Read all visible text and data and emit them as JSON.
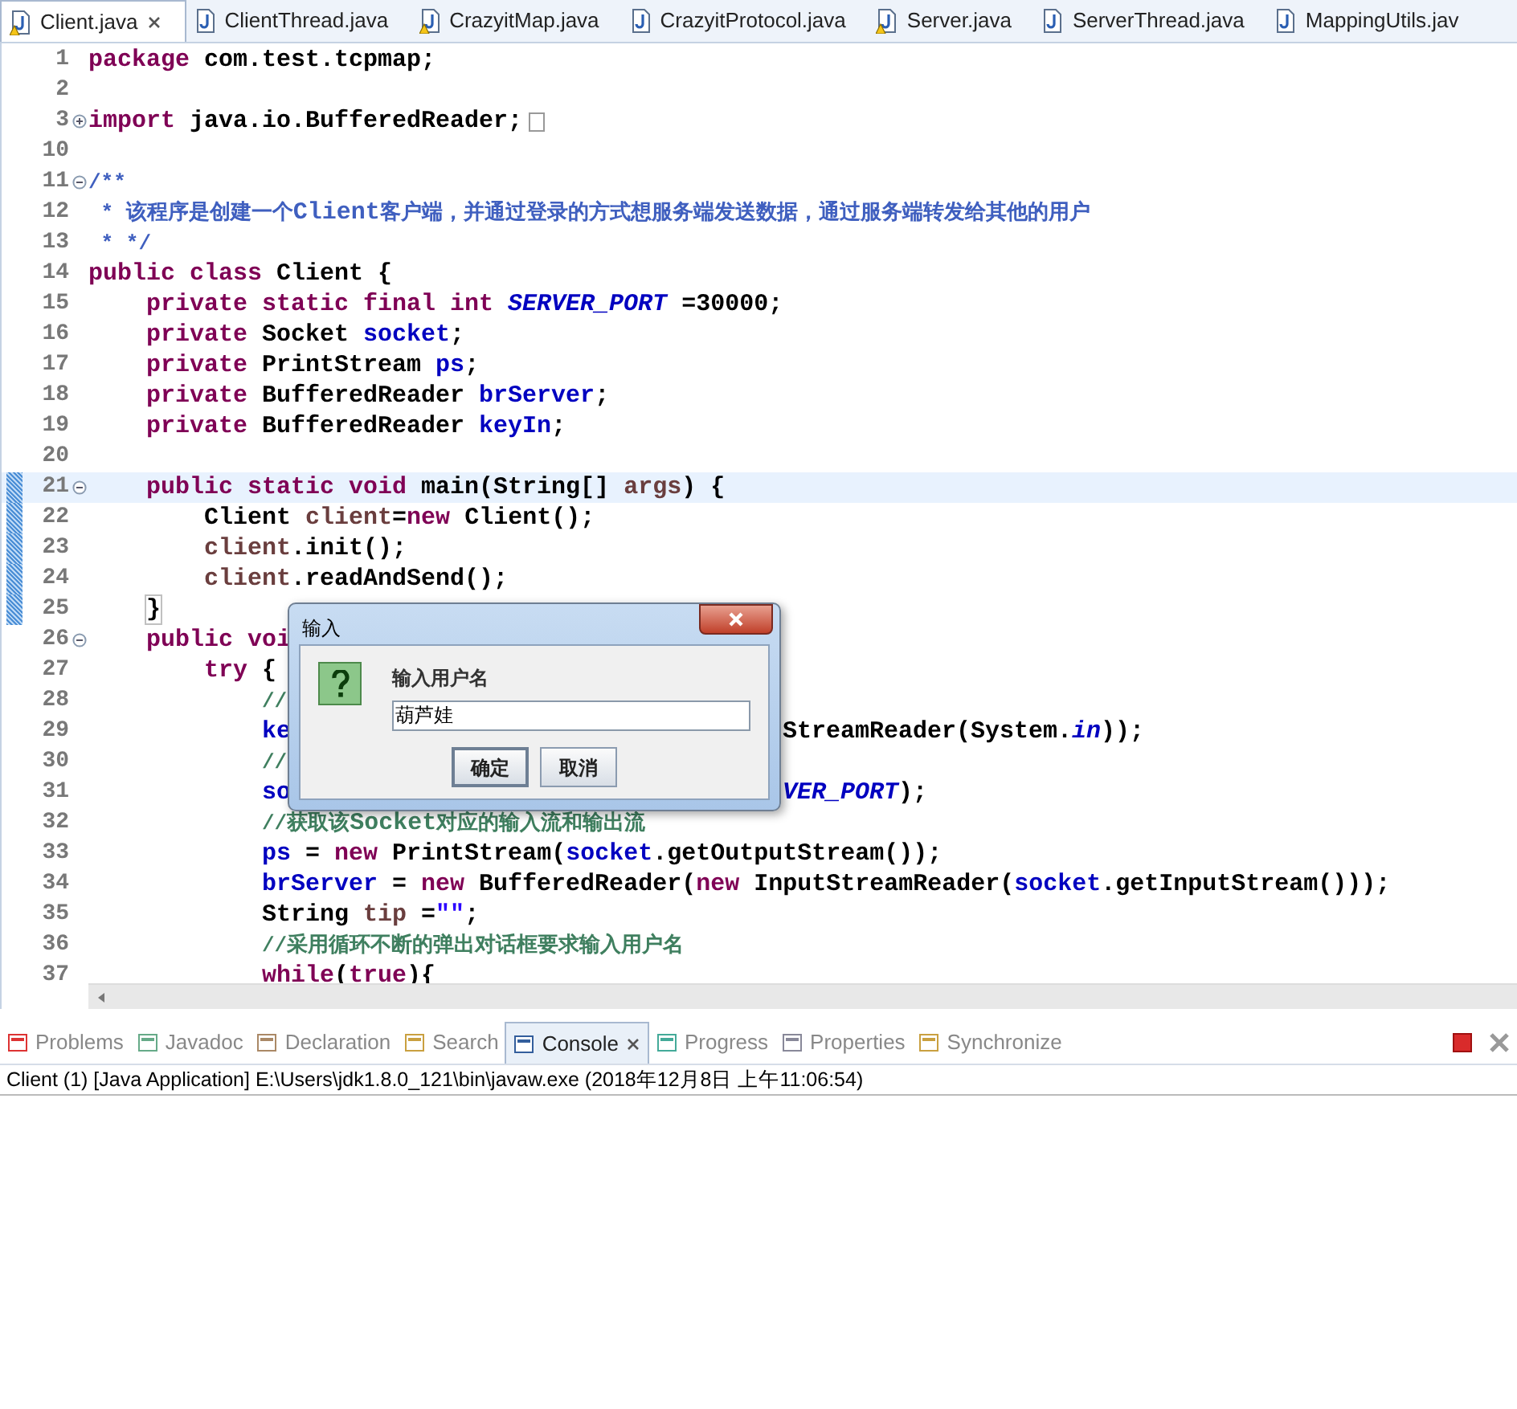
{
  "editor_tabs": [
    {
      "label": "Client.java",
      "selected": true,
      "warning": true
    },
    {
      "label": "ClientThread.java",
      "selected": false,
      "warning": false
    },
    {
      "label": "CrazyitMap.java",
      "selected": false,
      "warning": true
    },
    {
      "label": "CrazyitProtocol.java",
      "selected": false,
      "warning": false
    },
    {
      "label": "Server.java",
      "selected": false,
      "warning": true
    },
    {
      "label": "ServerThread.java",
      "selected": false,
      "warning": false
    },
    {
      "label": "MappingUtils.jav",
      "selected": false,
      "warning": false
    }
  ],
  "code_lines": [
    {
      "number": "1",
      "current": false,
      "changed": false,
      "tokens": [
        {
          "kind": "keyword",
          "text": "package"
        },
        {
          "kind": "plain",
          "text": " com.test.tcpmap;"
        }
      ]
    },
    {
      "number": "2",
      "current": false,
      "changed": false
    },
    {
      "number": "3",
      "current": false,
      "changed": false,
      "expanded": false,
      "tokens": [
        {
          "kind": "keyword",
          "text": "import"
        },
        {
          "kind": "plain",
          "text": " java.io.BufferedReader;"
        }
      ]
    },
    {
      "number": "10",
      "current": false,
      "changed": false
    },
    {
      "number": "11",
      "current": false,
      "changed": false,
      "expanded": true,
      "tokens": [
        {
          "kind": "javadoc",
          "text": "/**"
        }
      ]
    },
    {
      "number": "12",
      "current": false,
      "changed": false,
      "tokens": [
        {
          "kind": "javadoc",
          "text": " * 该程序是创建一个"
        },
        {
          "kind": "javadoc_bold",
          "text": "Client"
        },
        {
          "kind": "javadoc",
          "text": "客户端，并通过登录的方式想服务端发送数据，通过服务端转发给其他的用户"
        }
      ]
    },
    {
      "number": "13",
      "current": false,
      "changed": false,
      "tokens": [
        {
          "kind": "javadoc",
          "text": " * */"
        }
      ]
    },
    {
      "number": "14",
      "current": false,
      "changed": false,
      "tokens": [
        {
          "kind": "keyword",
          "text": "public class"
        },
        {
          "kind": "plain",
          "text": " Client {"
        }
      ],
      "children": [
        {
          "number": "15",
          "current": false,
          "changed": false,
          "tokens": [
            {
              "kind": "keyword",
              "text": "private static final int "
            },
            {
              "kind": "constant",
              "text": "SERVER_PORT"
            },
            {
              "kind": "plain",
              "text": " =30000;"
            }
          ]
        },
        {
          "number": "16",
          "current": false,
          "changed": false,
          "tokens": [
            {
              "kind": "keyword",
              "text": "private"
            },
            {
              "kind": "plain",
              "text": " Socket "
            },
            {
              "kind": "field",
              "text": "socket"
            },
            {
              "kind": "plain",
              "text": ";"
            }
          ]
        },
        {
          "number": "17",
          "current": false,
          "changed": false,
          "tokens": [
            {
              "kind": "keyword",
              "text": "private"
            },
            {
              "kind": "plain",
              "text": " PrintStream "
            },
            {
              "kind": "field",
              "text": "ps"
            },
            {
              "kind": "plain",
              "text": ";"
            }
          ]
        },
        {
          "number": "18",
          "current": false,
          "changed": false,
          "tokens": [
            {
              "kind": "keyword",
              "text": "private"
            },
            {
              "kind": "plain",
              "text": " BufferedReader "
            },
            {
              "kind": "field",
              "text": "brServer"
            },
            {
              "kind": "plain",
              "text": ";"
            }
          ]
        },
        {
          "number": "19",
          "current": false,
          "changed": false,
          "tokens": [
            {
              "kind": "keyword",
              "text": "private"
            },
            {
              "kind": "plain",
              "text": " BufferedReader "
            },
            {
              "kind": "field",
              "text": "keyIn"
            },
            {
              "kind": "plain",
              "text": ";"
            }
          ]
        },
        {
          "number": "20",
          "current": false,
          "changed": false
        },
        {
          "number": "21",
          "current": true,
          "changed": true,
          "expanded": true,
          "tokens": [
            {
              "kind": "keyword",
              "text": "public static void"
            },
            {
              "kind": "plain",
              "text": " main(String[] "
            },
            {
              "kind": "local",
              "text": "args"
            },
            {
              "kind": "plain",
              "text": ") {"
            }
          ],
          "children": [
            {
              "number": "22",
              "current": false,
              "changed": true,
              "tokens": [
                {
                  "kind": "plain",
                  "text": "Client "
                },
                {
                  "kind": "local",
                  "text": "client"
                },
                {
                  "kind": "plain",
                  "text": "="
                },
                {
                  "kind": "keyword",
                  "text": "new"
                },
                {
                  "kind": "plain",
                  "text": " Client();"
                }
              ]
            },
            {
              "number": "23",
              "current": false,
              "changed": true,
              "tokens": [
                {
                  "kind": "local",
                  "text": "client"
                },
                {
                  "kind": "plain",
                  "text": ".init();"
                }
              ]
            },
            {
              "number": "24",
              "current": false,
              "changed": true,
              "tokens": [
                {
                  "kind": "local",
                  "text": "client"
                },
                {
                  "kind": "plain",
                  "text": ".readAndSend();"
                }
              ]
            }
          ]
        },
        {
          "number": "25",
          "current": false,
          "changed": true,
          "tokens": [
            {
              "kind": "bracket_match",
              "text": "}"
            }
          ]
        },
        {
          "number": "26",
          "current": false,
          "changed": false,
          "expanded": true,
          "tokens": [
            {
              "kind": "keyword",
              "text": "public voi"
            }
          ],
          "children": [
            {
              "number": "27",
              "current": false,
              "changed": false,
              "tokens": [
                {
                  "kind": "keyword",
                  "text": "try"
                },
                {
                  "kind": "plain",
                  "text": " {"
                }
              ],
              "children": [
                {
                  "number": "28",
                  "current": false,
                  "changed": false,
                  "tokens": [
                    {
                      "kind": "comment",
                      "text": "//"
                    }
                  ]
                },
                {
                  "number": "29",
                  "current": false,
                  "changed": false,
                  "tokens": [
                    {
                      "kind": "field",
                      "text": "ke"
                    }
                  ],
                  "right": [
                    {
                      "kind": "plain",
                      "text": "StreamReader(System."
                    },
                    {
                      "kind": "constant",
                      "text": "in"
                    },
                    {
                      "kind": "plain",
                      "text": "));"
                    }
                  ]
                },
                {
                  "number": "30",
                  "current": false,
                  "changed": false,
                  "tokens": [
                    {
                      "kind": "comment",
                      "text": "//"
                    }
                  ]
                },
                {
                  "number": "31",
                  "current": false,
                  "changed": false,
                  "tokens": [
                    {
                      "kind": "field",
                      "text": "so"
                    }
                  ],
                  "right": [
                    {
                      "kind": "constant",
                      "text": "VER_PORT"
                    },
                    {
                      "kind": "plain",
                      "text": ");"
                    }
                  ]
                },
                {
                  "number": "32",
                  "current": false,
                  "changed": false,
                  "tokens": [
                    {
                      "kind": "comment",
                      "text": "//获取该"
                    },
                    {
                      "kind": "comment_bold",
                      "text": "Socket"
                    },
                    {
                      "kind": "comment",
                      "text": "对应的输入流和输出流"
                    }
                  ]
                },
                {
                  "number": "33",
                  "current": false,
                  "changed": false,
                  "tokens": [
                    {
                      "kind": "field",
                      "text": "ps"
                    },
                    {
                      "kind": "plain",
                      "text": " = "
                    },
                    {
                      "kind": "keyword",
                      "text": "new"
                    },
                    {
                      "kind": "plain",
                      "text": " PrintStream("
                    },
                    {
                      "kind": "field",
                      "text": "socket"
                    },
                    {
                      "kind": "plain",
                      "text": ".getOutputStream());"
                    }
                  ]
                },
                {
                  "number": "34",
                  "current": false,
                  "changed": false,
                  "tokens": [
                    {
                      "kind": "field",
                      "text": "brServer"
                    },
                    {
                      "kind": "plain",
                      "text": " = "
                    },
                    {
                      "kind": "keyword",
                      "text": "new"
                    },
                    {
                      "kind": "plain",
                      "text": " BufferedReader("
                    },
                    {
                      "kind": "keyword",
                      "text": "new"
                    },
                    {
                      "kind": "plain",
                      "text": " InputStreamReader("
                    },
                    {
                      "kind": "field",
                      "text": "socket"
                    },
                    {
                      "kind": "plain",
                      "text": ".getInputStream()));"
                    }
                  ]
                },
                {
                  "number": "35",
                  "current": false,
                  "changed": false,
                  "tokens": [
                    {
                      "kind": "plain",
                      "text": "String "
                    },
                    {
                      "kind": "local",
                      "text": "tip"
                    },
                    {
                      "kind": "plain",
                      "text": " ="
                    },
                    {
                      "kind": "string",
                      "text": "\"\""
                    },
                    {
                      "kind": "plain",
                      "text": ";"
                    }
                  ]
                },
                {
                  "number": "36",
                  "current": false,
                  "changed": false,
                  "tokens": [
                    {
                      "kind": "comment",
                      "text": "//采用循环不断的弹出对话框要求输入用户名"
                    }
                  ]
                },
                {
                  "number": "37",
                  "current": false,
                  "changed": false,
                  "tokens": [
                    {
                      "kind": "keyword",
                      "text": "while"
                    },
                    {
                      "kind": "plain",
                      "text": "("
                    },
                    {
                      "kind": "keyword",
                      "text": "true"
                    },
                    {
                      "kind": "plain",
                      "text": "){"
                    }
                  ]
                }
              ]
            }
          ]
        }
      ]
    }
  ],
  "dialog": {
    "title": "输入",
    "prompt": "输入用户名",
    "value": "葫芦娃",
    "buttons": [
      {
        "label": "确定",
        "default": true
      },
      {
        "label": "取消",
        "default": false
      }
    ]
  },
  "bottom_tabs": [
    {
      "label": "Problems",
      "selected": false
    },
    {
      "label": "Javadoc",
      "selected": false
    },
    {
      "label": "Declaration",
      "selected": false
    },
    {
      "label": "Search",
      "selected": false
    },
    {
      "label": "Console",
      "selected": true
    },
    {
      "label": "Progress",
      "selected": false
    },
    {
      "label": "Properties",
      "selected": false
    },
    {
      "label": "Synchronize",
      "selected": false
    }
  ],
  "console": {
    "header": "Client (1) [Java Application] E:\\Users\\jdk1.8.0_121\\bin\\javaw.exe (2018年12月8日 上午11:06:54)"
  }
}
